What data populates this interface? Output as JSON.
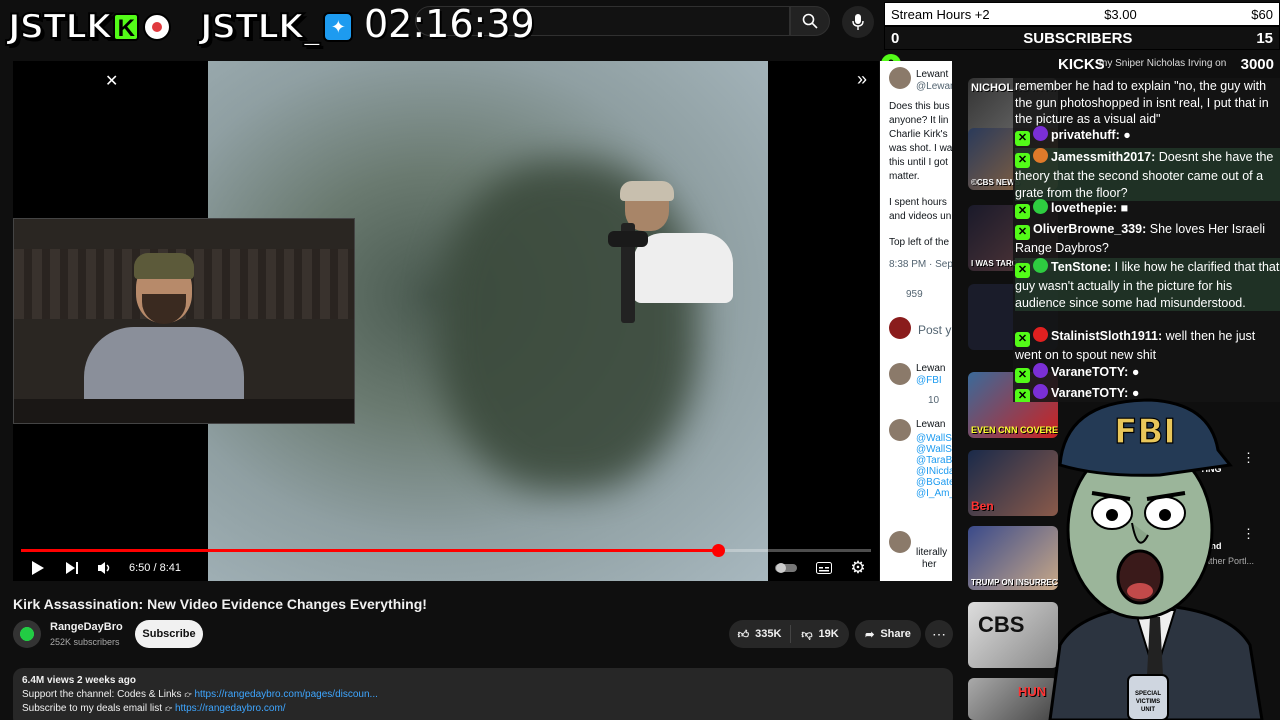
{
  "overlay": {
    "logo1": "JSTLK",
    "logo1_k": "K",
    "logo2": "JSTLK_",
    "clock": "02:16:39"
  },
  "stats": {
    "row1_left": "Stream Hours +2",
    "row1_mid": "$3.00",
    "row1_right": "$60",
    "row2_left": "0",
    "row2_mid": "SUBSCRIBERS",
    "row2_right": "15",
    "kicks_count": "0",
    "kicks_label": "KICKS",
    "kicks_value": "3000",
    "kicks_scroll": "my Sniper Nicholas Irving on"
  },
  "player": {
    "time": "6:50 / 8:41",
    "progress": 0.82
  },
  "tweet": {
    "handle": "Lewant",
    "handle2": "@Lewan",
    "l1": "Does this bus",
    "l2": "anyone? It lin",
    "l3": "Charlie Kirk's",
    "l4": "was shot. I wa",
    "l5": "this until I got",
    "l6": "matter.",
    "l7": "I spent hours",
    "l8": "and videos un",
    "l9": "Top left of the",
    "l10": "8:38 PM · Sep 10",
    "l11": "959",
    "l12": "Post y",
    "l13": "Lewan",
    "l14": "@FBI",
    "l15": "10",
    "l16": "Lewan",
    "l17": "@WallSt",
    "l18": "@WallSt",
    "l19": "@TaraBu",
    "l20": "@INicda",
    "l21": "@BGates",
    "l22": "@I_Am_",
    "l23": "literally",
    "l24": "her"
  },
  "video": {
    "title": "Kirk Assassination: New Video Evidence Changes Everything!",
    "channel": "RangeDayBro",
    "subs": "252K subscribers",
    "subscribe": "Subscribe",
    "likes": "335K",
    "dislikes": "19K",
    "share": "Share",
    "views": "6.4M views  2 weeks ago",
    "desc1": "Support the channel: Codes & Links",
    "desc1_link": "https://rangedaybro.com/pages/discoun...",
    "desc2": "Subscribe to my deals email list",
    "desc2_link": "https://rangedaybro.com/"
  },
  "chat": [
    {
      "user": "",
      "text": "remember he had to explain \"no, the guy with the gun photoshopped in isnt real, I put that in the picture as a visual aid\"",
      "color": ""
    },
    {
      "user": "privatehuff:",
      "text": "",
      "color": "#7b2fd6"
    },
    {
      "user": "Jamessmith2017:",
      "text": "Doesnt she have the theory that the second shooter came out of a grate from the floor?",
      "color": "#e07a2a"
    },
    {
      "user": "lovethepie:",
      "text": "",
      "color": "#2ecc40"
    },
    {
      "user": "OliverBrowne_339:",
      "text": "She loves Her Israeli Range Daybros?",
      "color": ""
    },
    {
      "user": "TenStone:",
      "text": "I like how he clarified that that guy wasn't actually in the picture for his audience since some had misunderstood.",
      "color": "#2ecc40"
    },
    {
      "user": "StalinistSloth1911:",
      "text": "well then he just went on to spout new shit",
      "color": "#e02020"
    },
    {
      "user": "VaraneTOTY:",
      "text": "",
      "color": "#7b2fd6"
    },
    {
      "user": "VaraneTOTY:",
      "text": "",
      "color": "#7b2fd6"
    }
  ],
  "recs": [
    {
      "cap": "NICHOLAS IRVING"
    },
    {
      "cap": "©CBS NEWS"
    },
    {
      "cap": "I WAS TARGE"
    },
    {
      "cap": ""
    },
    {
      "cap": "EVEN CNN COVERED IT!"
    },
    {
      "cap": "Ben"
    },
    {
      "cap": "TRUMP ON INSURRECTION A"
    },
    {
      "cap": "CBS"
    },
    {
      "cap": "HUN"
    }
  ],
  "rec_titles": {
    "t1": "TING",
    "t2": "ng",
    "t3": "tland",
    "t4": "eather Portl...",
    "t5": "2)"
  },
  "fbi_text": "FBI",
  "fbi_badge": "SPECIAL VICTIMS UNIT",
  "colors": {
    "accent": "#ff0000",
    "kick": "#53fc18",
    "twitter": "#1d9bf0"
  }
}
